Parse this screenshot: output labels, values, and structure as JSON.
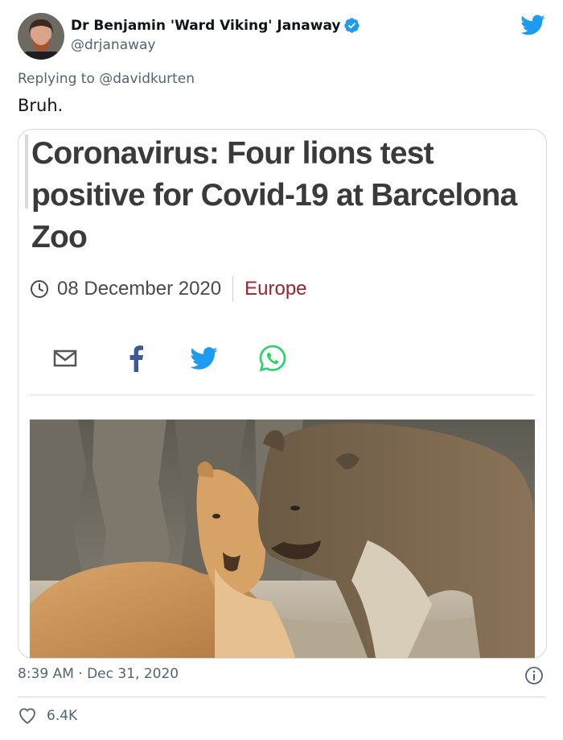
{
  "user": {
    "display_name": "Dr Benjamin 'Ward Viking' Janaway",
    "handle": "@drjanaway",
    "verified": true
  },
  "reply": {
    "prefix": "Replying to",
    "mention": "@davidkurten"
  },
  "tweet_text": "Bruh.",
  "card": {
    "headline": "Coronavirus: Four lions test positive for Covid-19 at Barcelona Zoo",
    "date": "08 December 2020",
    "section": "Europe",
    "share_icons": [
      "email-icon",
      "facebook-icon",
      "twitter-icon",
      "whatsapp-icon"
    ]
  },
  "footer": {
    "timestamp": "8:39 AM · Dec 31, 2020",
    "like_count": "6.4K"
  },
  "colors": {
    "twitter_blue": "#1d9bf0",
    "muted_text": "#536471",
    "section_red": "#a0222a",
    "facebook_blue": "#3b5998",
    "whatsapp_green": "#25d366"
  }
}
